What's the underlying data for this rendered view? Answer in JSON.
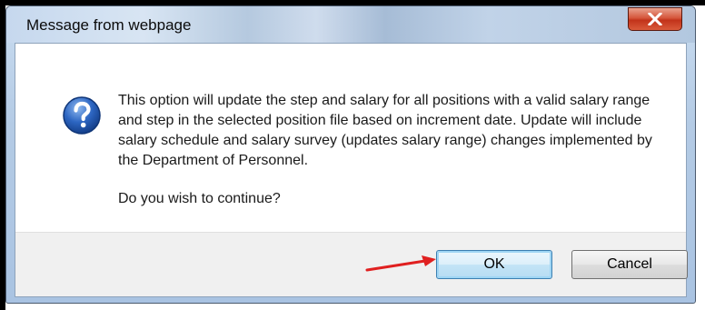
{
  "dialog": {
    "title": "Message from webpage",
    "close_icon": "close-x-icon",
    "message_icon": "question-icon",
    "message": "This option will update the step and salary for all positions with a valid salary range and step in the selected position file based on increment date. Update will include salary schedule and salary survey (updates salary range) changes implemented by the Department of Personnel.",
    "question": "Do you wish to continue?",
    "buttons": {
      "ok_label": "OK",
      "cancel_label": "Cancel"
    },
    "annotation": {
      "arrow_icon": "red-arrow-icon",
      "color": "#e02020"
    }
  }
}
